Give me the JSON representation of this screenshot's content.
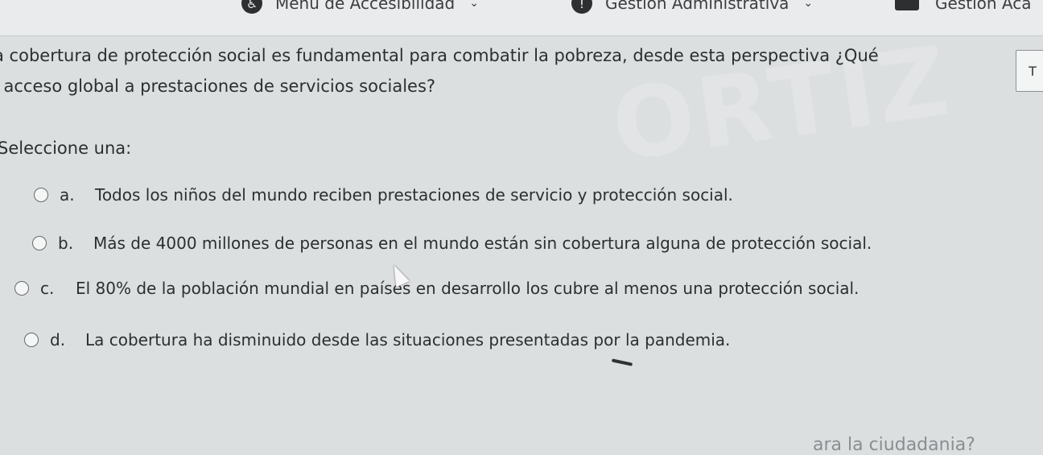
{
  "header": {
    "accessibility_menu": "Menú de Accesibilidad",
    "admin_management": "Gestión Administrativa",
    "academic_management": "Gestión Aca"
  },
  "question": {
    "line1": "a cobertura de protección social es fundamental para combatir la pobreza, desde esta perspectiva ¿Qué",
    "line2": "l acceso global a prestaciones de servicios sociales?",
    "flag_label": "T",
    "prompt": "Seleccione una:"
  },
  "options": [
    {
      "letter": "a.",
      "text": "Todos los niños del mundo reciben prestaciones de servicio y protección social."
    },
    {
      "letter": "b.",
      "text": "Más de 4000 millones de personas en el mundo están sin cobertura alguna de protección social."
    },
    {
      "letter": "c.",
      "text": "El 80% de la población mundial en países en desarrollo los cubre al menos una protección social."
    },
    {
      "letter": "d.",
      "text": "La cobertura ha disminuido desde las situaciones presentadas por la pandemia."
    }
  ],
  "watermark_text": "ORTIZ",
  "footer_fragment": "ara la ciudadania?"
}
